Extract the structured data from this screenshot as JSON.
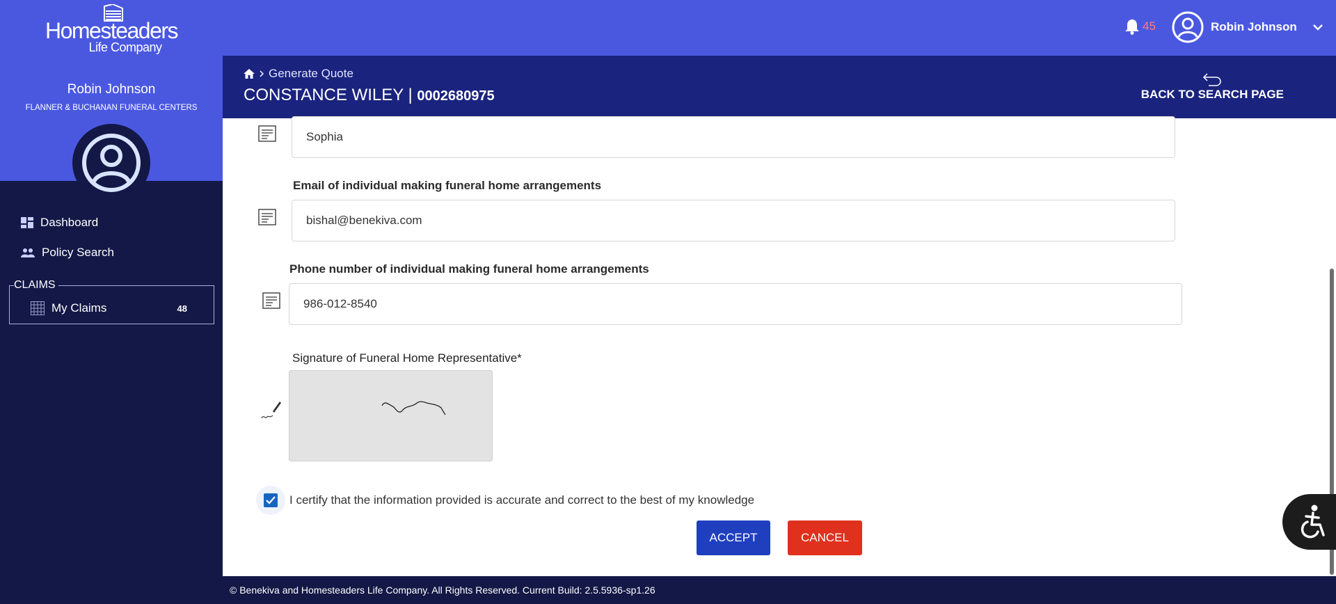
{
  "brand": {
    "logo_name": "Homesteaders",
    "logo_sub": "Life Company"
  },
  "sidebar": {
    "user_name": "Robin Johnson",
    "user_org": "FLANNER & BUCHANAN FUNERAL CENTERS",
    "items": [
      {
        "label": "Dashboard",
        "icon": "dashboard-icon"
      },
      {
        "label": "Policy Search",
        "icon": "people-icon"
      }
    ],
    "claims": {
      "title": "CLAIMS",
      "item_label": "My Claims",
      "item_count": "48"
    }
  },
  "topbar": {
    "notifications_count": "45",
    "user_name": "Robin Johnson"
  },
  "header": {
    "breadcrumb_current": "Generate Quote",
    "title_name": "CONSTANCE WILEY | ",
    "title_number": "0002680975",
    "back_label": "BACK TO SEARCH PAGE"
  },
  "form": {
    "first_name_value": "Sophia",
    "email_label": "Email of individual making funeral home arrangements",
    "email_value": "bishal@benekiva.com",
    "phone_label": "Phone number of individual making funeral home arrangements",
    "phone_value": "986-012-8540",
    "signature_label": "Signature of Funeral Home Representative*",
    "certify_text": "I certify that the information provided is accurate and correct to the best of my knowledge",
    "certify_checked": true,
    "accept_label": "ACCEPT",
    "cancel_label": "CANCEL"
  },
  "footer": {
    "text": "© Benekiva and Homesteaders Life Company. All Rights Reserved. Current Build: 2.5.5936-sp1.26"
  },
  "colors": {
    "sidebar_bg": "#131846",
    "topbar_bg": "#4a58e0",
    "header_bg": "#1a237e",
    "accept": "#1f3fbf",
    "cancel": "#e0301e",
    "notification": "#ff7d7d"
  }
}
